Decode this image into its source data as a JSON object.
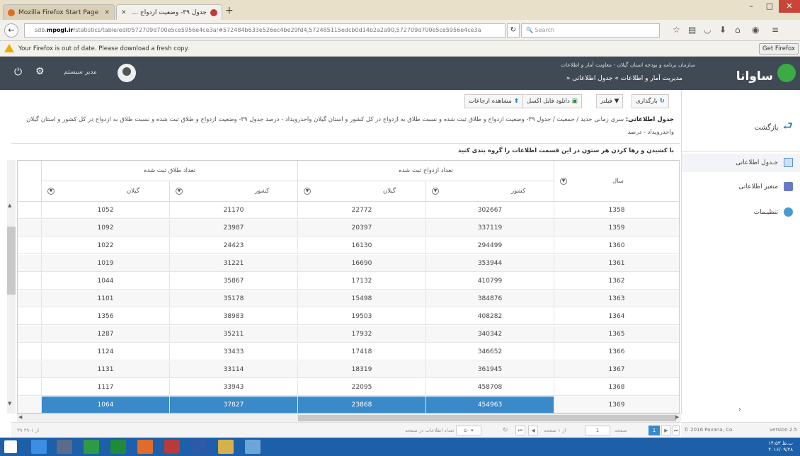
{
  "browser": {
    "tabs": [
      {
        "label": "Mozilla Firefox Start Page",
        "active": false
      },
      {
        "label": "جدول ۳۹- وضعیت ازدواج ...",
        "active": true
      }
    ],
    "new_tab_label": "+",
    "url_prefix": "sdb.",
    "url_host": "mpogl.ir",
    "url_path": "/statistics/table/edit/572709d700e5ce5956e4ce3a/#572484b633e526ec4be29fd4,572485115edcb0d14b2a2a90,572709d700e5ce5956e4ce3a",
    "search_placeholder": "Search",
    "window_controls": {
      "minimize": "–",
      "maximize": "□",
      "close": "✕"
    }
  },
  "notification": {
    "message": "Your Firefox is out of date. Please download a fresh copy.",
    "button": "Get Firefox"
  },
  "header": {
    "logo_text": "ساوانا",
    "org_line": "سازمان برنامه و بودجه استان گیلان - معاونت آمار و اطلاعات",
    "breadcrumb": "» مدیریت آمار و اطلاعات » جدول اطلاعاتی",
    "username": "مدیر سیستم"
  },
  "sidebar": {
    "back_label": "بازگشت",
    "items": [
      {
        "label": "جـدول اطلاعاتی",
        "icon": "table-icon"
      },
      {
        "label": "متغیر اطلاعاتی",
        "icon": "variable-icon"
      },
      {
        "label": "تنظیـمات",
        "icon": "settings-icon"
      }
    ],
    "copyright": "© 2016 Pavana, Co.",
    "version": "version 2.5"
  },
  "toolbar": {
    "reload": "بارگذاری",
    "filter": "فیلتر",
    "download_excel": "دانلود فایل اکسل",
    "view_references": "مشاهده ارجاعات"
  },
  "description": {
    "label": "جدول اطلاعاتی:",
    "text": "سری زمانی جدید / جمعیت / جدول ۳۹- وضعیت ازدواج و طلاق ثبت شده و نسبت طلاق به ازدواج در کل کشور و استان گیلان واحدرویداد - درصد جدول ۳۹- وضعیت ازدواج و طلاق ثبت شده و نسبت طلاق به ازدواج در کل کشور و استان گیلان واحدرویداد - درصد",
    "drag_note": "با کشیدن و رها کردن هر ستون در این قسمت اطلاعات را گروه بندی کنید"
  },
  "table": {
    "group_headers": {
      "marriage": "تعداد ازدواج ثبت شده",
      "divorce": "تعداد طلاق ثبت شده"
    },
    "columns": {
      "year": "سال",
      "country": "کشور",
      "gilan": "گیلان"
    },
    "rows": [
      {
        "year": "1358",
        "m_country": "302667",
        "m_gilan": "22772",
        "d_country": "21170",
        "d_gilan": "1052"
      },
      {
        "year": "1359",
        "m_country": "337119",
        "m_gilan": "20397",
        "d_country": "23987",
        "d_gilan": "1092"
      },
      {
        "year": "1360",
        "m_country": "294499",
        "m_gilan": "16130",
        "d_country": "24423",
        "d_gilan": "1022"
      },
      {
        "year": "1361",
        "m_country": "353944",
        "m_gilan": "16690",
        "d_country": "31221",
        "d_gilan": "1019"
      },
      {
        "year": "1362",
        "m_country": "410799",
        "m_gilan": "17132",
        "d_country": "35867",
        "d_gilan": "1044"
      },
      {
        "year": "1363",
        "m_country": "384876",
        "m_gilan": "15498",
        "d_country": "35178",
        "d_gilan": "1101"
      },
      {
        "year": "1364",
        "m_country": "408282",
        "m_gilan": "19503",
        "d_country": "38983",
        "d_gilan": "1356"
      },
      {
        "year": "1365",
        "m_country": "340342",
        "m_gilan": "17932",
        "d_country": "35211",
        "d_gilan": "1287"
      },
      {
        "year": "1366",
        "m_country": "346652",
        "m_gilan": "17418",
        "d_country": "33433",
        "d_gilan": "1124"
      },
      {
        "year": "1367",
        "m_country": "361945",
        "m_gilan": "18319",
        "d_country": "33114",
        "d_gilan": "1131"
      },
      {
        "year": "1368",
        "m_country": "458708",
        "m_gilan": "22095",
        "d_country": "33943",
        "d_gilan": "1117"
      },
      {
        "year": "1369",
        "m_country": "454963",
        "m_gilan": "23868",
        "d_country": "37827",
        "d_gilan": "1064",
        "selected": true
      }
    ]
  },
  "pager": {
    "range": "۳۹ از ۱-۳۹",
    "page_word": "صفحه",
    "page_input": "1",
    "of_pages": "از ۱ صفحه",
    "current": "1",
    "per_page": "۵۰",
    "per_page_label": "تعداد اطلاعات در صفحه"
  },
  "taskbar": {
    "clock": "۱۴:۵۳ ب.ظ",
    "date": "۲۰۱۶/۰۹/۲۸"
  },
  "colors": {
    "header_bg": "#3f4a54",
    "selection": "#3a89c9",
    "brand_green": "#3dab45",
    "taskbar": "#1d5fa8"
  }
}
